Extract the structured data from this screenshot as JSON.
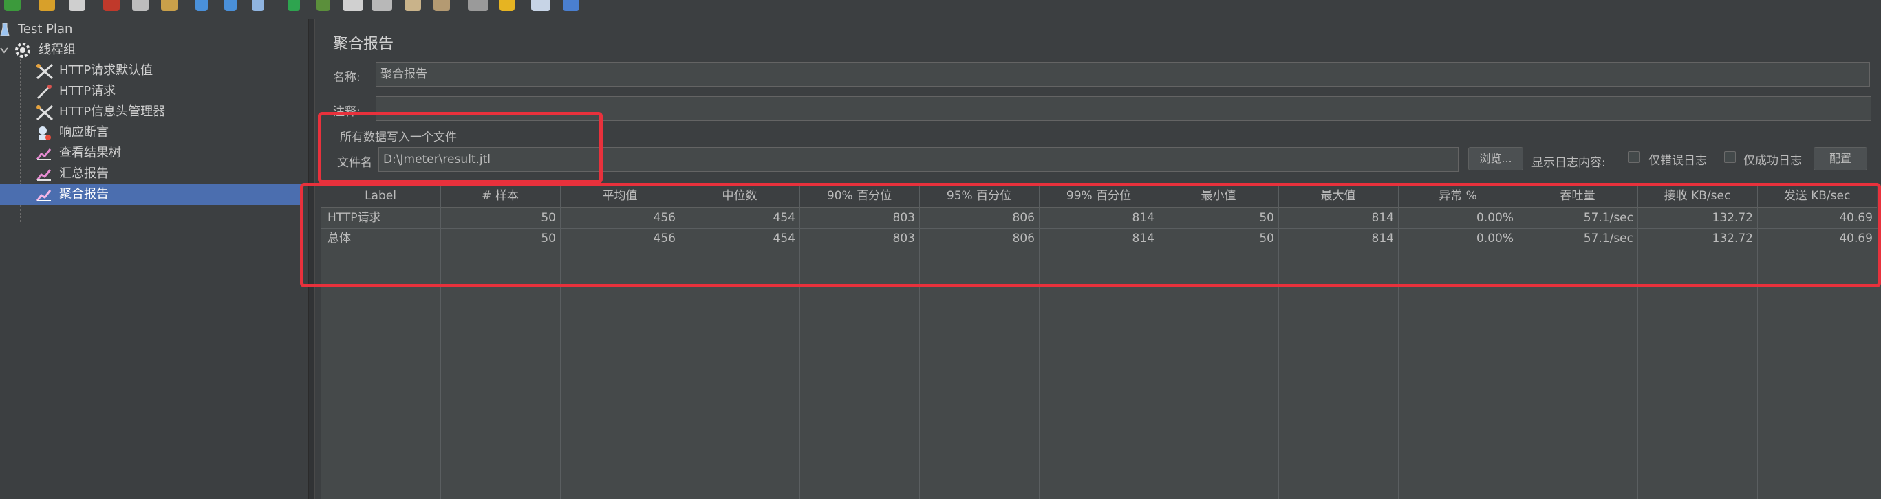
{
  "toolbar": {
    "icons": [
      "new-icon",
      "open-icon",
      "save-icon",
      "cut-icon",
      "copy-icon",
      "paste-icon",
      "expand-icon",
      "collapse-icon",
      "toggle-icon",
      "start-icon",
      "start-no-pause-icon",
      "stop-icon",
      "shutdown-icon",
      "clear-icon",
      "clear-all-icon",
      "search-icon",
      "reset-search-icon",
      "function-helper-icon",
      "help-icon"
    ]
  },
  "tree": {
    "items": [
      {
        "label": "Test Plan",
        "icon": "flask-icon"
      },
      {
        "label": "线程组",
        "icon": "gear-icon"
      },
      {
        "label": "HTTP请求默认值",
        "icon": "wrench-icon"
      },
      {
        "label": "HTTP请求",
        "icon": "pipette-icon"
      },
      {
        "label": "HTTP信息头管理器",
        "icon": "wrench-icon"
      },
      {
        "label": "响应断言",
        "icon": "assertion-icon"
      },
      {
        "label": "查看结果树",
        "icon": "chart-icon"
      },
      {
        "label": "汇总报告",
        "icon": "chart-icon"
      },
      {
        "label": "聚合报告",
        "icon": "chart-icon"
      }
    ],
    "selected": "聚合报告"
  },
  "panel": {
    "title": "聚合报告",
    "name_label": "名称:",
    "name_value": "聚合报告",
    "comment_label": "注释:",
    "comment_value": "",
    "file_group_title": "所有数据写入一个文件",
    "file_label": "文件名",
    "file_value": "D:\\Jmeter\\result.jtl",
    "browse_label": "浏览...",
    "log_content_label": "显示日志内容:",
    "errors_only_label": "仅错误日志",
    "success_only_label": "仅成功日志",
    "configure_label": "配置"
  },
  "table": {
    "headers": [
      "Label",
      "# 样本",
      "平均值",
      "中位数",
      "90% 百分位",
      "95% 百分位",
      "99% 百分位",
      "最小值",
      "最大值",
      "异常 %",
      "吞吐量",
      "接收 KB/sec",
      "发送 KB/sec"
    ],
    "rows": [
      [
        "HTTP请求",
        "50",
        "456",
        "454",
        "803",
        "806",
        "814",
        "50",
        "814",
        "0.00%",
        "57.1/sec",
        "132.72",
        "40.69"
      ],
      [
        "总体",
        "50",
        "456",
        "454",
        "803",
        "806",
        "814",
        "50",
        "814",
        "0.00%",
        "57.1/sec",
        "132.72",
        "40.69"
      ]
    ]
  },
  "colors": {
    "background": "#3c3f41",
    "selection": "#4b6eaf",
    "highlight": "#e8313c"
  }
}
